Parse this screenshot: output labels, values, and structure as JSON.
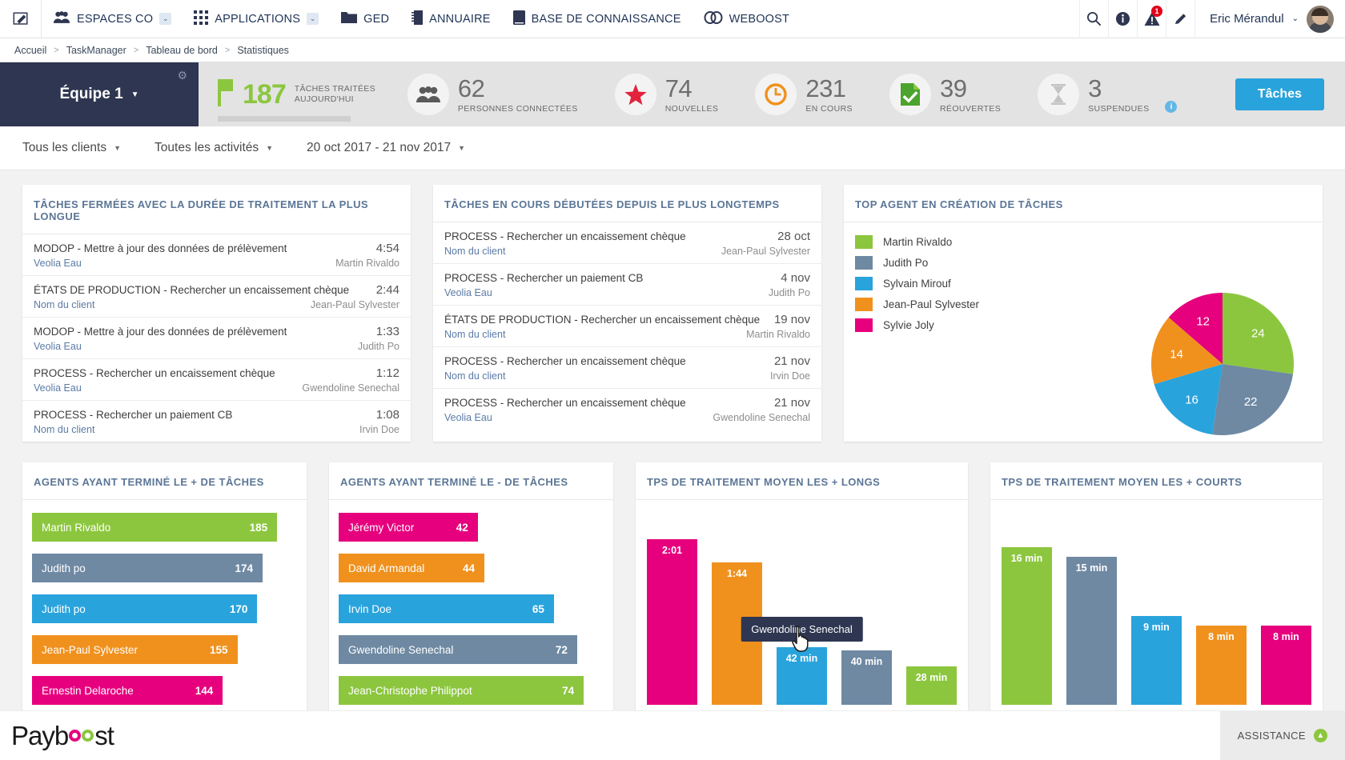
{
  "topnav": {
    "edit_icon": "pencil-square-icon",
    "items": [
      {
        "label": "ESPACES CO",
        "icon": "users-icon",
        "caret": "⌄"
      },
      {
        "label": "APPLICATIONS",
        "icon": "grid-icon",
        "caret": "⌄"
      },
      {
        "label": "GED",
        "icon": "folder-icon"
      },
      {
        "label": "ANNUAIRE",
        "icon": "book-icon"
      },
      {
        "label": "BASE DE CONNAISSANCE",
        "icon": "book-closed-icon"
      },
      {
        "label": "WEBOOST",
        "icon": "link-icon"
      }
    ],
    "search_icon": "search-icon",
    "info_icon": "info-icon",
    "alert_icon": "alert-triangle-icon",
    "alert_badge": "1",
    "pencil_icon": "pencil-icon",
    "user_name": "Eric Mérandul",
    "user_caret": "⌄"
  },
  "breadcrumb": {
    "items": [
      "Accueil",
      "TaskManager",
      "Tableau de bord",
      "Statistiques"
    ],
    "separator": ">"
  },
  "kpibar": {
    "team_label": "Équipe 1",
    "team_caret": "▼",
    "gear_icon": "gear-icon",
    "processed": {
      "icon": "flag-icon",
      "value": "187",
      "label_line1": "TÂCHES TRAITÉES",
      "label_line2": "AUJOURD'HUI",
      "progress_percent": 67
    },
    "stats": [
      {
        "icon": "people-icon",
        "value": "62",
        "label": "PERSONNES CONNECTÉES"
      },
      {
        "icon": "star-icon",
        "value": "74",
        "label": "NOUVELLES"
      },
      {
        "icon": "clock-icon",
        "value": "231",
        "label": "EN COURS"
      },
      {
        "icon": "doc-check-icon",
        "value": "39",
        "label": "RÉOUVERTES"
      },
      {
        "icon": "hourglass-icon",
        "value": "3",
        "label": "SUSPENDUES",
        "info": "i"
      }
    ],
    "action_button": "Tâches"
  },
  "filters": [
    {
      "label": "Tous les clients"
    },
    {
      "label": "Toutes les activités"
    },
    {
      "label": "20 oct 2017 - 21 nov 2017"
    }
  ],
  "cards": {
    "closed_longest": {
      "title": "TÂCHES FERMÉES AVEC LA DURÉE DE TRAITEMENT LA PLUS LONGUE",
      "rows": [
        {
          "title": "MODOP - Mettre à jour des données de prélèvement",
          "duration": "4:54",
          "client": "Veolia Eau",
          "agent": "Martin Rivaldo"
        },
        {
          "title": "ÉTATS DE PRODUCTION - Rechercher un encaissement chèque",
          "duration": "2:44",
          "client": "Nom du client",
          "agent": "Jean-Paul Sylvester"
        },
        {
          "title": "MODOP - Mettre à jour des données de prélèvement",
          "duration": "1:33",
          "client": "Veolia Eau",
          "agent": "Judith Po"
        },
        {
          "title": "PROCESS - Rechercher un encaissement chèque",
          "duration": "1:12",
          "client": "Veolia Eau",
          "agent": "Gwendoline Senechal"
        },
        {
          "title": "PROCESS - Rechercher un paiement CB",
          "duration": "1:08",
          "client": "Nom du client",
          "agent": "Irvin Doe"
        }
      ]
    },
    "inprogress_oldest": {
      "title": "TÂCHES EN COURS DÉBUTÉES DEPUIS LE PLUS LONGTEMPS",
      "rows": [
        {
          "title": "PROCESS - Rechercher un encaissement chèque",
          "duration": "28 oct",
          "client": "Nom du client",
          "agent": "Jean-Paul Sylvester"
        },
        {
          "title": "PROCESS - Rechercher un paiement CB",
          "duration": "4 nov",
          "client": "Veolia Eau",
          "agent": "Judith Po"
        },
        {
          "title": "ÉTATS DE PRODUCTION - Rechercher un encaissement chèque",
          "duration": "19 nov",
          "client": "Nom du client",
          "agent": "Martin Rivaldo"
        },
        {
          "title": "PROCESS - Rechercher un encaissement chèque",
          "duration": "21 nov",
          "client": "Nom du client",
          "agent": "Irvin Doe"
        },
        {
          "title": "PROCESS - Rechercher un encaissement chèque",
          "duration": "21 nov",
          "client": "Veolia Eau",
          "agent": "Gwendoline Senechal"
        }
      ]
    },
    "top_agent_pie": {
      "title": "TOP AGENT EN CRÉATION DE TÂCHES"
    },
    "most_tasks": {
      "title": "AGENTS AYANT TERMINÉ LE + DE TÂCHES"
    },
    "least_tasks": {
      "title": "AGENTS AYANT TERMINÉ LE - DE TÂCHES"
    },
    "longest_avg": {
      "title": "TPS DE TRAITEMENT MOYEN LES + LONGS"
    },
    "shortest_avg": {
      "title": "TPS DE TRAITEMENT MOYEN LES + COURTS"
    }
  },
  "tooltip": {
    "text": "Gwendoline Senechal"
  },
  "footer": {
    "logo_part1": "Payb",
    "logo_part2": "st",
    "assistance_label": "ASSISTANCE",
    "assistance_icon": "arrow-up-icon"
  },
  "palette": {
    "green": "#8cc63e",
    "slate": "#6f89a3",
    "blue": "#29a3dc",
    "orange": "#f0911e",
    "pink": "#e6007e",
    "navy": "#2e3651",
    "title_blue": "#5b7696"
  },
  "chart_data": [
    {
      "type": "pie",
      "title": "TOP AGENT EN CRÉATION DE TÂCHES",
      "categories": [
        "Martin Rivaldo",
        "Judith Po",
        "Sylvain Mirouf",
        "Jean-Paul Sylvester",
        "Sylvie Joly"
      ],
      "values": [
        24,
        22,
        16,
        14,
        12
      ],
      "colors": [
        "#8cc63e",
        "#6f89a3",
        "#29a3dc",
        "#f0911e",
        "#e6007e"
      ],
      "legend": "left",
      "labels_inside": true
    },
    {
      "type": "bar",
      "orientation": "horizontal",
      "title": "AGENTS AYANT TERMINÉ LE + DE TÂCHES",
      "categories": [
        "Martin Rivaldo",
        "Judith po",
        "Judith po",
        "Jean-Paul Sylvester",
        "Ernestin Delaroche"
      ],
      "values": [
        185,
        174,
        170,
        155,
        144
      ],
      "colors": [
        "#8cc63e",
        "#6f89a3",
        "#29a3dc",
        "#f0911e",
        "#e6007e"
      ],
      "xlabel": "",
      "ylabel": "",
      "xlim": [
        0,
        200
      ]
    },
    {
      "type": "bar",
      "orientation": "horizontal",
      "title": "AGENTS AYANT TERMINÉ LE - DE TÂCHES",
      "categories": [
        "Jérémy Victor",
        "David Armandal",
        "Irvin Doe",
        "Gwendoline Senechal",
        "Jean-Christophe Philippot"
      ],
      "values": [
        42,
        44,
        65,
        72,
        74
      ],
      "colors": [
        "#e6007e",
        "#f0911e",
        "#29a3dc",
        "#6f89a3",
        "#8cc63e"
      ],
      "xlabel": "",
      "ylabel": "",
      "xlim": [
        0,
        80
      ]
    },
    {
      "type": "bar",
      "orientation": "vertical",
      "title": "TPS DE TRAITEMENT MOYEN LES + LONGS",
      "categories": [
        "",
        "",
        "",
        "",
        ""
      ],
      "value_labels": [
        "2:01",
        "1:44",
        "42 min",
        "40 min",
        "28 min"
      ],
      "values": [
        121,
        104,
        42,
        40,
        28
      ],
      "colors": [
        "#e6007e",
        "#f0911e",
        "#29a3dc",
        "#6f89a3",
        "#8cc63e"
      ],
      "unit": "minutes",
      "ylim": [
        0,
        130
      ]
    },
    {
      "type": "bar",
      "orientation": "vertical",
      "title": "TPS DE TRAITEMENT MOYEN LES + COURTS",
      "categories": [
        "",
        "",
        "",
        "",
        ""
      ],
      "value_labels": [
        "16 min",
        "15 min",
        "9 min",
        "8 min",
        "8 min"
      ],
      "values": [
        16,
        15,
        9,
        8,
        8
      ],
      "colors": [
        "#8cc63e",
        "#6f89a3",
        "#29a3dc",
        "#f0911e",
        "#e6007e"
      ],
      "unit": "minutes",
      "ylim": [
        0,
        18
      ]
    }
  ]
}
